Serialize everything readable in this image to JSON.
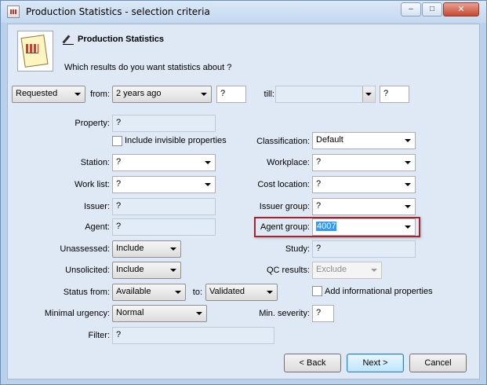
{
  "window": {
    "title": "Production Statistics - selection criteria",
    "minimize_glyph": "–",
    "maximize_glyph": "□",
    "close_glyph": "✕"
  },
  "header": {
    "heading": "Production Statistics",
    "question": "Which results do you want statistics about ?"
  },
  "date_row": {
    "mode": "Requested",
    "from_label": "from:",
    "from_value": "2 years ago",
    "from_extra": "?",
    "till_label": "till:",
    "till_value": "",
    "till_extra": "?"
  },
  "fields": {
    "property_label": "Property:",
    "property_value": "?",
    "include_invisible_label": "Include invisible properties",
    "classification_label": "Classification:",
    "classification_value": "Default",
    "station_label": "Station:",
    "station_value": "?",
    "workplace_label": "Workplace:",
    "workplace_value": "?",
    "worklist_label": "Work list:",
    "worklist_value": "?",
    "cost_location_label": "Cost location:",
    "cost_location_value": "?",
    "issuer_label": "Issuer:",
    "issuer_value": "?",
    "issuer_group_label": "Issuer group:",
    "issuer_group_value": "?",
    "agent_label": "Agent:",
    "agent_value": "?",
    "agent_group_label": "Agent group:",
    "agent_group_value": "4007",
    "unassessed_label": "Unassessed:",
    "unassessed_value": "Include",
    "study_label": "Study:",
    "study_value": "?",
    "unsolicited_label": "Unsolicited:",
    "unsolicited_value": "Include",
    "qc_results_label": "QC results:",
    "qc_results_value": "Exclude",
    "status_from_label": "Status from:",
    "status_from_value": "Available",
    "status_to_label": "to:",
    "status_to_value": "Validated",
    "add_informational_label": "Add informational properties",
    "minimal_urgency_label": "Minimal urgency:",
    "minimal_urgency_value": "Normal",
    "min_severity_label": "Min. severity:",
    "min_severity_value": "?",
    "filter_label": "Filter:",
    "filter_value": "?"
  },
  "buttons": {
    "back": "< Back",
    "next": "Next >",
    "cancel": "Cancel"
  }
}
